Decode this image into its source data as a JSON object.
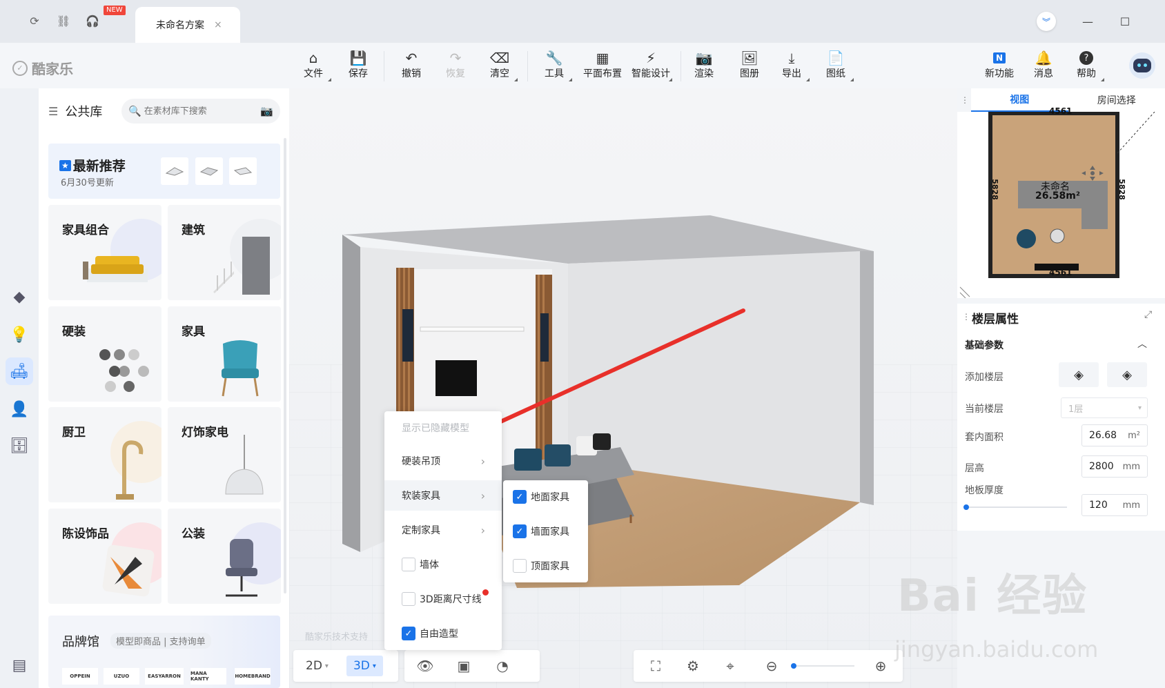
{
  "doc_tab": {
    "title": "未命名方案",
    "close": "×",
    "new_badge": "NEW"
  },
  "logo": {
    "text": "酷家乐"
  },
  "toolbar": {
    "file": "文件",
    "save": "保存",
    "undo": "撤销",
    "redo": "恢复",
    "clear": "清空",
    "tools": "工具",
    "floor_plan": "平面布置",
    "smart_design": "智能设计",
    "render": "渲染",
    "album": "图册",
    "export": "导出",
    "drawings": "图纸",
    "new_features": "新功能",
    "messages": "消息",
    "help": "帮助"
  },
  "library": {
    "title": "公共库",
    "search_placeholder": "在素材库下搜索",
    "recommend_title": "最新推荐",
    "recommend_sub": "6月30号更新",
    "categories": [
      "家具组合",
      "建筑",
      "硬装",
      "家具",
      "厨卫",
      "灯饰家电",
      "陈设饰品",
      "公装"
    ],
    "brand_title": "品牌馆",
    "brand_sub": "模型即商品 | 支持询单",
    "brands": [
      "OPPEIN",
      "UZUO",
      "EASYARRON",
      "MANA KANTY",
      "HOMEBRAND"
    ]
  },
  "viewport": {
    "tech_support": "酷家乐技术支持"
  },
  "view_controls": {
    "mode_2d": "2D",
    "mode_3d": "3D"
  },
  "context_menu": {
    "show_hidden": "显示已隐藏模型",
    "hard_ceiling": "硬装吊顶",
    "soft_furniture": "软装家具",
    "custom_furniture": "定制家具",
    "wall": "墙体",
    "dimension_3d": "3D距离尺寸线",
    "free_model": "自由造型"
  },
  "submenu": {
    "floor": "地面家具",
    "wall": "墙面家具",
    "ceiling": "顶面家具"
  },
  "minimap": {
    "tab_view": "视图",
    "tab_room": "房间选择",
    "room_name": "未命名",
    "room_area": "26.58m²",
    "dim_top": "4561",
    "dim_bottom": "4561",
    "dim_left": "5828",
    "dim_right": "5828"
  },
  "floor_props": {
    "title": "楼层属性",
    "section": "基础参数",
    "add_floor": "添加楼层",
    "current_floor": "当前楼层",
    "current_floor_value": "1层",
    "inner_area": "套内面积",
    "inner_area_value": "26.68",
    "inner_area_unit": "m²",
    "floor_height": "层高",
    "floor_height_value": "2800",
    "floor_height_unit": "mm",
    "slab_thickness": "地板厚度",
    "slab_value": "120",
    "slab_unit": "mm"
  },
  "watermark": {
    "brand": "Bai 经验",
    "url": "jingyan.baidu.com"
  },
  "colors": {
    "accent": "#1a73e8",
    "arrow": "#e8302a",
    "floor_wood": "#c8a27a",
    "wall": "#cfd1d4"
  }
}
